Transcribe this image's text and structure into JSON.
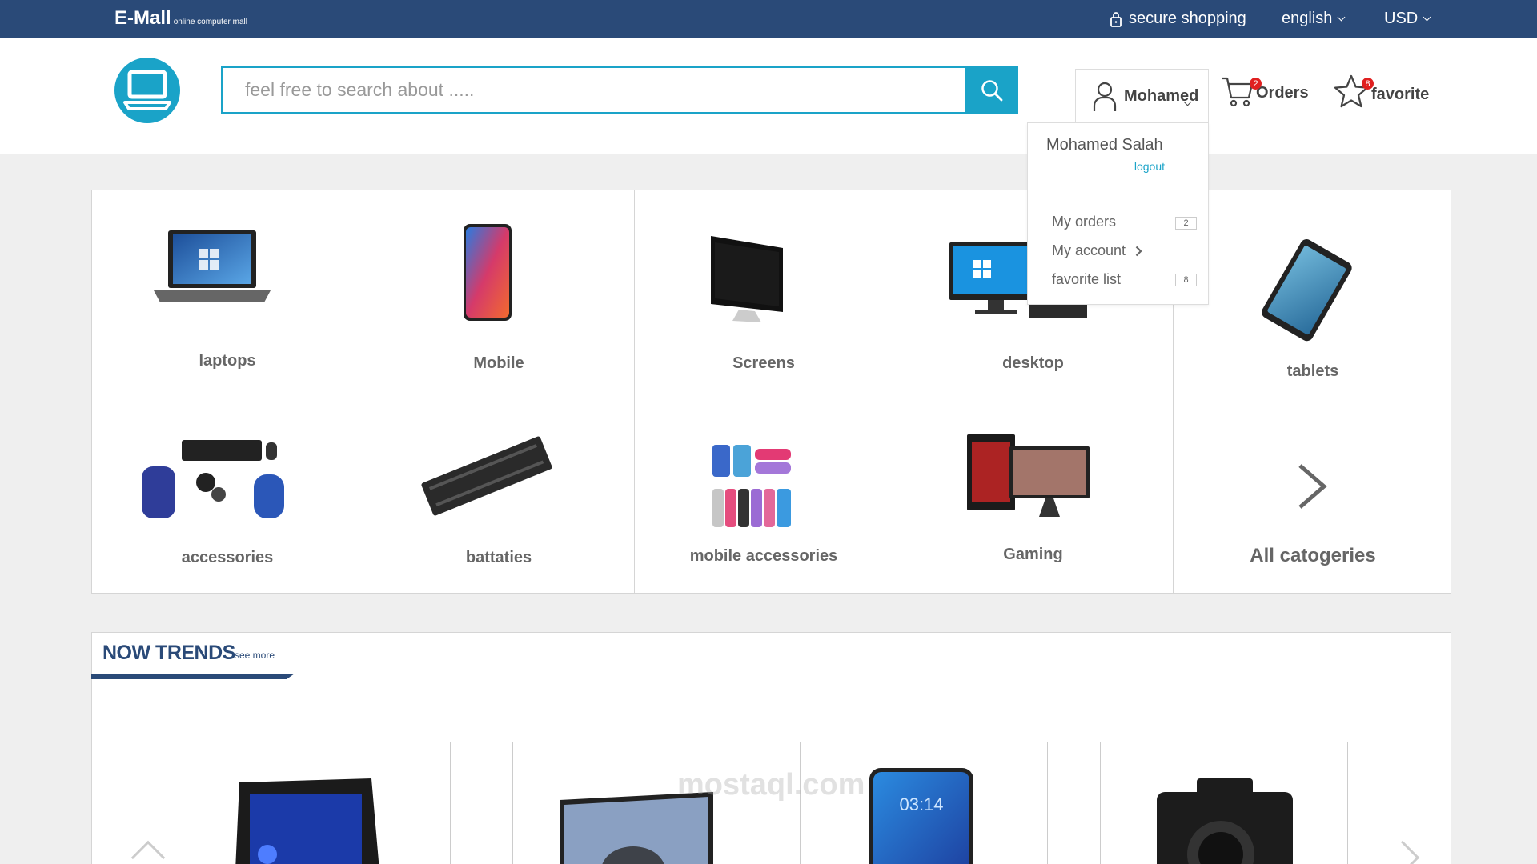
{
  "topbar": {
    "brand": "E-Mall",
    "brand_sub": "online computer mall",
    "secure": "secure shopping",
    "language": "english",
    "currency": "USD"
  },
  "header": {
    "search_placeholder": "feel free to search about .....",
    "user_short": "Mohamed",
    "orders_label": "Orders",
    "orders_badge": "2",
    "favorite_label": "favorite",
    "favorite_badge": "8"
  },
  "user_menu": {
    "full_name": "Mohamed Salah",
    "logout": "logout",
    "items": [
      {
        "label": "My orders",
        "count": "2"
      },
      {
        "label": "My account"
      },
      {
        "label": "favorite list",
        "count": "8"
      }
    ]
  },
  "categories": [
    {
      "label": "laptops"
    },
    {
      "label": "Mobile"
    },
    {
      "label": "Screens"
    },
    {
      "label": "desktop"
    },
    {
      "label": "tablets"
    },
    {
      "label": "accessories"
    },
    {
      "label": "battaties"
    },
    {
      "label": "mobile accessories"
    },
    {
      "label": "Gaming"
    },
    {
      "label": "All catogeries"
    }
  ],
  "trends": {
    "title": "NOW TRENDS",
    "see_more": "see more",
    "phone_time": "03:14"
  },
  "watermark": "mostaql.com",
  "colors": {
    "topbar": "#2a4a78",
    "accent": "#1aa3c8",
    "badge": "#e02020"
  }
}
